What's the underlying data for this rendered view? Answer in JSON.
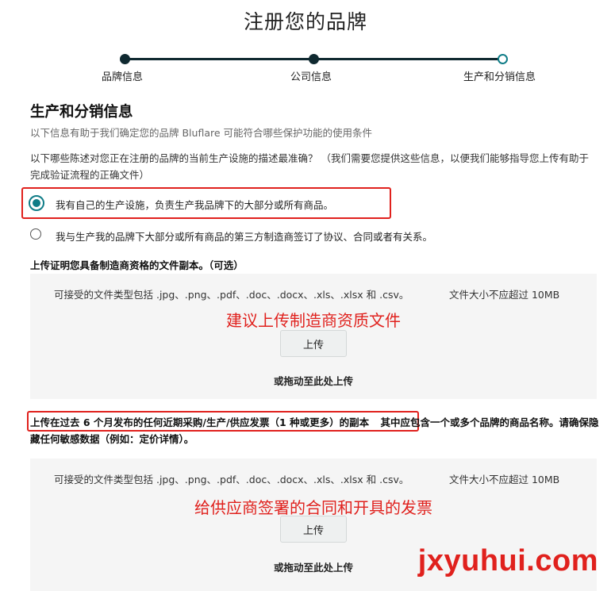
{
  "page": {
    "title": "注册您的品牌"
  },
  "stepper": {
    "steps": [
      {
        "label": "品牌信息",
        "state": "completed"
      },
      {
        "label": "公司信息",
        "state": "completed"
      },
      {
        "label": "生产和分销信息",
        "state": "current"
      }
    ]
  },
  "section": {
    "title": "生产和分销信息",
    "subtitle": "以下信息有助于我们确定您的品牌 Bluflare 可能符合哪些保护功能的使用条件"
  },
  "question": {
    "text": "以下哪些陈述对您正在注册的品牌的当前生产设施的描述最准确？ （我们需要您提供这些信息，以便我们能够指导您上传有助于完成验证流程的正确文件）",
    "options": [
      {
        "label": "我有自己的生产设施，负责生产我品牌下的大部分或所有商品。",
        "selected": true
      },
      {
        "label": "我与生产我的品牌下大部分或所有商品的第三方制造商签订了协议、合同或者有关系。",
        "selected": false
      }
    ]
  },
  "upload1": {
    "heading": "上传证明您具备制造商资格的文件副本。（可选）",
    "file_types": "可接受的文件类型包括 .jpg、.png、.pdf、.doc、.docx、.xls、.xlsx 和 .csv。",
    "size_limit": "文件大小不应超过 10MB",
    "annotation": "建议上传制造商资质文件",
    "button": "上传",
    "drag_text": "或拖动至此处上传"
  },
  "upload2": {
    "heading_part1": "上传在过去 6 个月发布的任何近期采购/生产/供应发票（1 种或更多）的副本",
    "heading_part2": "其中应包含一个或多个品牌的商品名称。请确保隐藏任何敏感数据（例如：定价详情）。",
    "file_types": "可接受的文件类型包括 .jpg、.png、.pdf、.doc、.docx、.xls、.xlsx 和 .csv。",
    "size_limit": "文件大小不应超过 10MB",
    "annotation": "给供应商签署的合同和开具的发票",
    "button": "上传",
    "drag_text": "或拖动至此处上传"
  },
  "watermark": "jxyuhui.com",
  "colors": {
    "accent": "#0f7c87",
    "annotation_red": "#e0211d",
    "stepper_dark": "#0f2930"
  }
}
